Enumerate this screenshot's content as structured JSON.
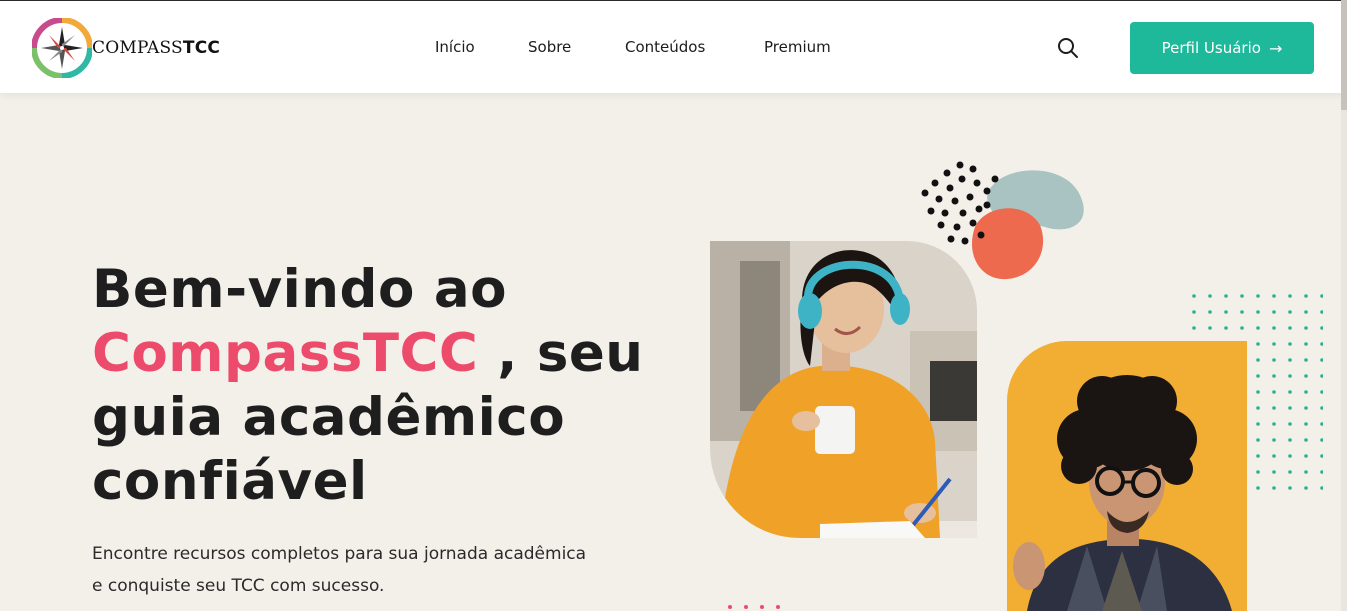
{
  "header": {
    "brand_main": "COMPASS",
    "brand_bold": "TCC",
    "logo_ring_text": "COMPASSTCC",
    "nav": [
      "Início",
      "Sobre",
      "Conteúdos",
      "Premium"
    ],
    "cta_label": "Perfil Usuário",
    "cta_icon": "arrow-right-icon",
    "search_icon": "search-icon"
  },
  "hero": {
    "title_line1": "Bem-vindo ao",
    "title_accent": "CompassTCC",
    "title_line2_rest": " , seu",
    "title_line3": "guia acadêmico",
    "title_line4": "confiável",
    "subtitle_line1": "Encontre recursos completos para sua jornada acadêmica",
    "subtitle_line2": "e conquiste seu TCC com sucesso."
  },
  "colors": {
    "accent_pink": "#ec4b6b",
    "brand_green": "#1db99a",
    "background": "#f3f0ea",
    "coral": "#ee6a4f",
    "sage": "#a9c3c2",
    "mustard": "#f2ad33"
  }
}
